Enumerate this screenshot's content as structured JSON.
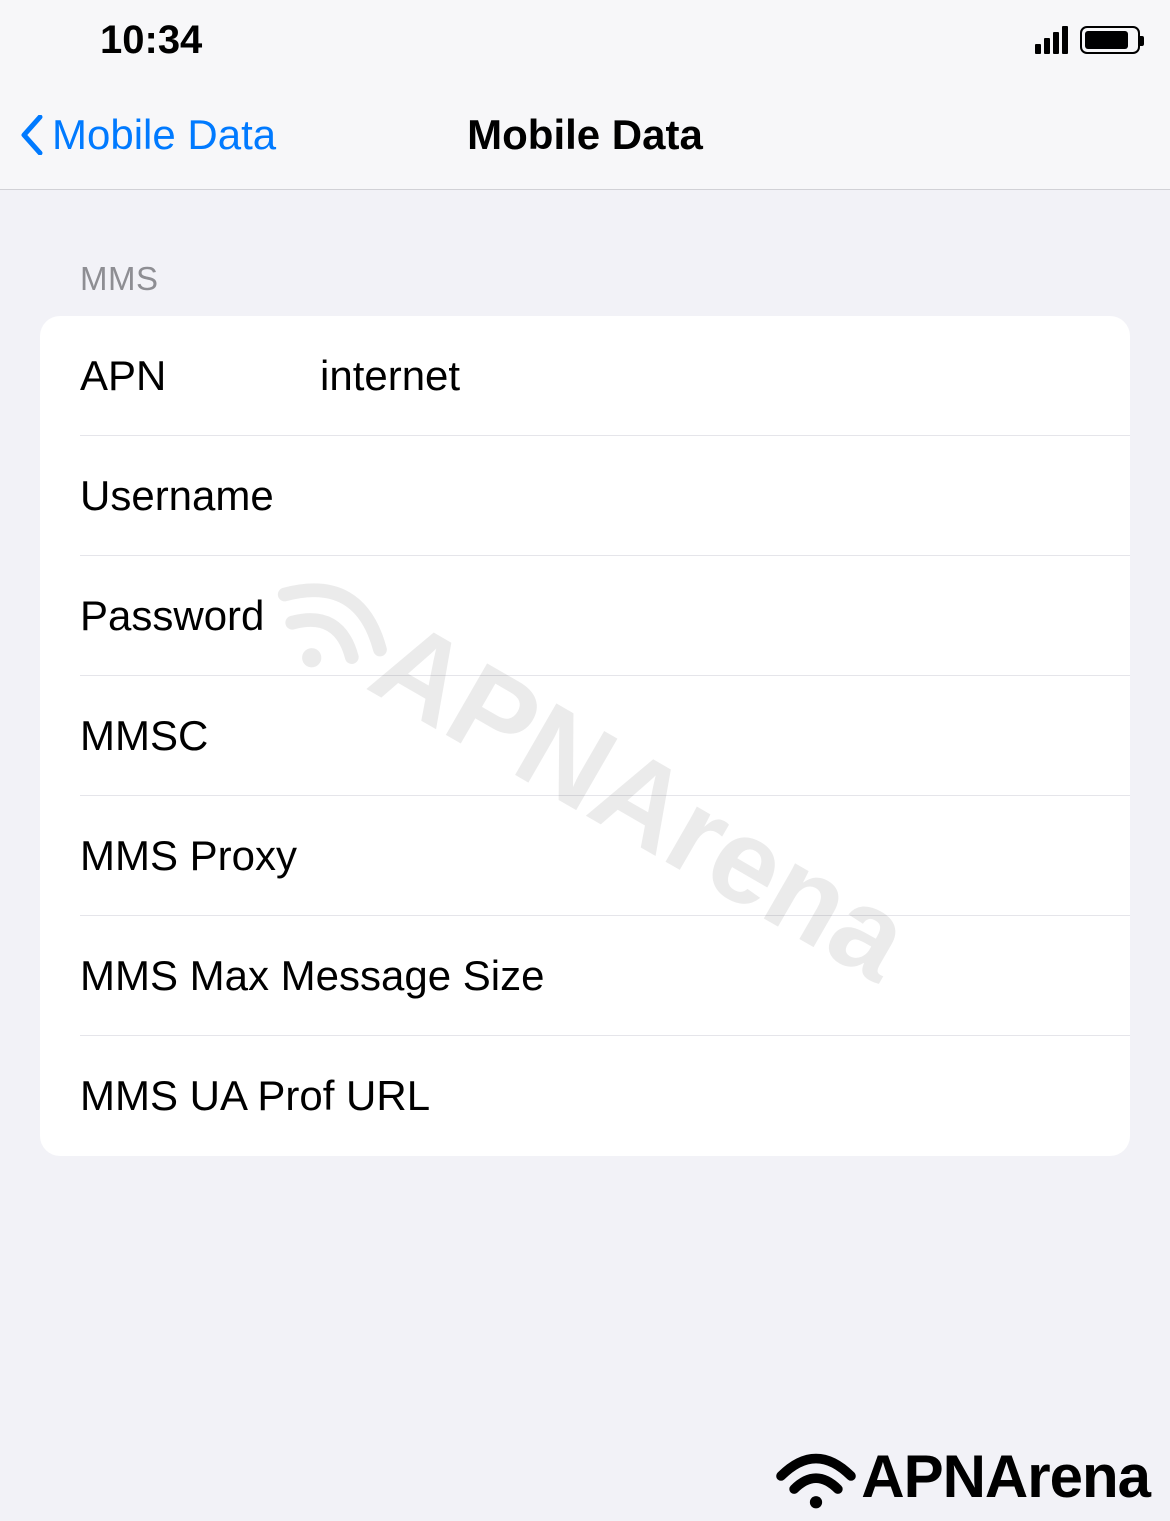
{
  "status_bar": {
    "time": "10:34"
  },
  "nav": {
    "back_label": "Mobile Data",
    "title": "Mobile Data"
  },
  "section_header": "MMS",
  "settings": {
    "apn": {
      "label": "APN",
      "value": "internet"
    },
    "username": {
      "label": "Username",
      "value": ""
    },
    "password": {
      "label": "Password",
      "value": ""
    },
    "mmsc": {
      "label": "MMSC",
      "value": ""
    },
    "mms_proxy": {
      "label": "MMS Proxy",
      "value": ""
    },
    "mms_max_size": {
      "label": "MMS Max Message Size",
      "value": ""
    },
    "mms_ua_prof": {
      "label": "MMS UA Prof URL",
      "value": ""
    }
  },
  "watermark": "APNArena",
  "footer_logo": "APNArena"
}
